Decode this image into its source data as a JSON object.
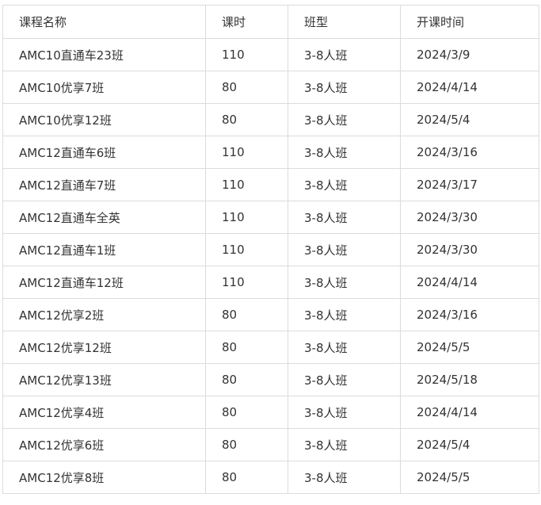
{
  "table": {
    "columns": [
      "课程名称",
      "课时",
      "班型",
      "开课时间"
    ],
    "rows": [
      [
        "AMC10直通车23班",
        "110",
        "3-8人班",
        "2024/3/9"
      ],
      [
        "AMC10优享7班",
        "80",
        "3-8人班",
        "2024/4/14"
      ],
      [
        "AMC10优享12班",
        "80",
        "3-8人班",
        "2024/5/4"
      ],
      [
        "AMC12直通车6班",
        "110",
        "3-8人班",
        "2024/3/16"
      ],
      [
        "AMC12直通车7班",
        "110",
        "3-8人班",
        "2024/3/17"
      ],
      [
        "AMC12直通车全英",
        "110",
        "3-8人班",
        "2024/3/30"
      ],
      [
        "AMC12直通车1班",
        "110",
        "3-8人班",
        "2024/3/30"
      ],
      [
        "AMC12直通车12班",
        "110",
        "3-8人班",
        "2024/4/14"
      ],
      [
        "AMC12优享2班",
        "80",
        "3-8人班",
        "2024/3/16"
      ],
      [
        "AMC12优享12班",
        "80",
        "3-8人班",
        "2024/5/5"
      ],
      [
        "AMC12优享13班",
        "80",
        "3-8人班",
        "2024/5/18"
      ],
      [
        "AMC12优享4班",
        "80",
        "3-8人班",
        "2024/4/14"
      ],
      [
        "AMC12优享6班",
        "80",
        "3-8人班",
        "2024/5/4"
      ],
      [
        "AMC12优享8班",
        "80",
        "3-8人班",
        "2024/5/5"
      ]
    ]
  }
}
